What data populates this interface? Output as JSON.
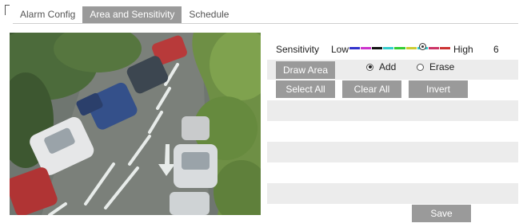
{
  "tabs": [
    {
      "label": "Alarm Config",
      "active": false
    },
    {
      "label": "Area and Sensitivity",
      "active": true
    },
    {
      "label": "Schedule",
      "active": false
    }
  ],
  "sensitivity": {
    "label": "Sensitivity",
    "low_label": "Low",
    "high_label": "High",
    "value": "6",
    "level_fraction": 0.72,
    "scale_colors": [
      "#3333cc",
      "#cc33cc",
      "#111111",
      "#33cccc",
      "#33cc33",
      "#cccc33",
      "#33cccc",
      "#cc3366",
      "#cc3333"
    ]
  },
  "area": {
    "draw_area_label": "Draw Area",
    "mode_options": [
      {
        "label": "Add",
        "selected": true
      },
      {
        "label": "Erase",
        "selected": false
      }
    ],
    "select_all_label": "Select All",
    "clear_all_label": "Clear All",
    "invert_label": "Invert"
  },
  "save_label": "Save",
  "colors": {
    "button_bg": "#9a9a9a",
    "active_tab_bg": "#9a9a9a",
    "stripe_bg": "#ececec"
  }
}
